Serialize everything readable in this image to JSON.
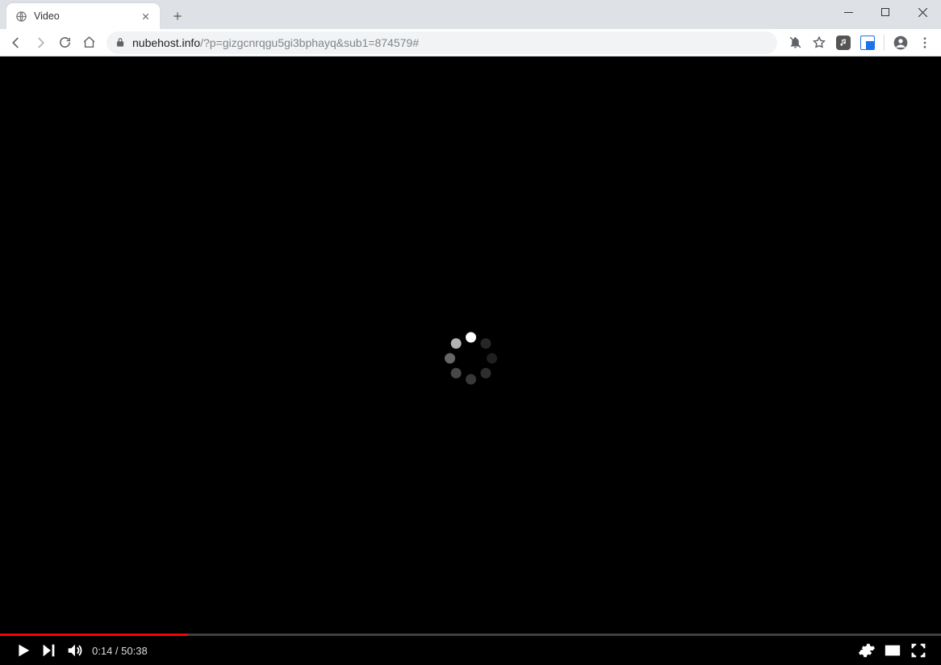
{
  "window": {
    "tab_title": "Video",
    "url_host": "nubehost.info",
    "url_path": "/?p=gizgcnrqgu5gi3bphayq&sub1=874579#"
  },
  "player": {
    "elapsed": "0:14",
    "duration": "50:38",
    "progress_percent": 20,
    "spinner_dots": [
      {
        "angle": 0,
        "opacity": 1.0
      },
      {
        "angle": 45,
        "opacity": 0.15
      },
      {
        "angle": 90,
        "opacity": 0.12
      },
      {
        "angle": 135,
        "opacity": 0.18
      },
      {
        "angle": 180,
        "opacity": 0.22
      },
      {
        "angle": 225,
        "opacity": 0.28
      },
      {
        "angle": 270,
        "opacity": 0.4
      },
      {
        "angle": 315,
        "opacity": 0.7
      }
    ]
  },
  "icons": {
    "time_sep": " / "
  }
}
